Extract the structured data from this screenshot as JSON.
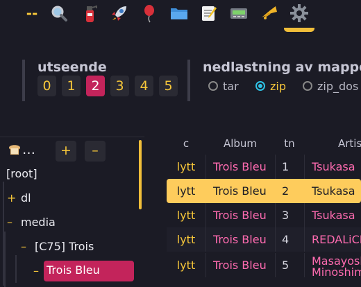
{
  "toolbar": {
    "ops_toggle": "--",
    "icons": [
      "search-icon",
      "fire-extinguisher-icon",
      "rocket-icon",
      "balloon-icon",
      "folder-icon",
      "memo-icon",
      "pager-icon",
      "trumpet-icon",
      "gear-icon"
    ],
    "active_icon": "gear-icon"
  },
  "theme": {
    "label": "utseende",
    "options": [
      "0",
      "1",
      "2",
      "3",
      "4",
      "5"
    ],
    "selected": "2"
  },
  "download": {
    "label": "nedlastning av mappe",
    "options": [
      {
        "label": "tar",
        "checked": false
      },
      {
        "label": "zip",
        "checked": true
      },
      {
        "label": "zip_dos",
        "checked": false
      }
    ]
  },
  "tree": {
    "title_icon": "bread-icon",
    "title_suffix": "…",
    "expand_label": "+",
    "collapse_label": "–",
    "nodes": [
      {
        "toggle": "",
        "label": "[root]"
      },
      {
        "toggle": "+",
        "label": "dl"
      },
      {
        "toggle": "–",
        "label": "media"
      },
      {
        "toggle": "–",
        "label": "[C75] Trois"
      },
      {
        "toggle": "–",
        "label": "Trois Bleu"
      }
    ]
  },
  "files": {
    "headers": [
      "c",
      "Album",
      "tn",
      "Artis"
    ],
    "rows": [
      {
        "c": "lytt",
        "album": "Trois Bleu",
        "tn": "1",
        "artist": "Tsukasa"
      },
      {
        "c": "lytt",
        "album": "Trois Bleu",
        "tn": "2",
        "artist": "Tsukasa"
      },
      {
        "c": "lytt",
        "album": "Trois Bleu",
        "tn": "3",
        "artist": "Tsukasa"
      },
      {
        "c": "lytt",
        "album": "Trois Bleu",
        "tn": "4",
        "artist": "REDALiCE"
      },
      {
        "c": "lytt",
        "album": "Trois Bleu",
        "tn": "5",
        "artist": "Masayosh Minoshim"
      }
    ],
    "selected_row": 2
  },
  "colors": {
    "accent": "#f7c73a",
    "selected": "#c3245b",
    "highlight_row": "#fecc5c",
    "link": "#ff6bb0"
  }
}
